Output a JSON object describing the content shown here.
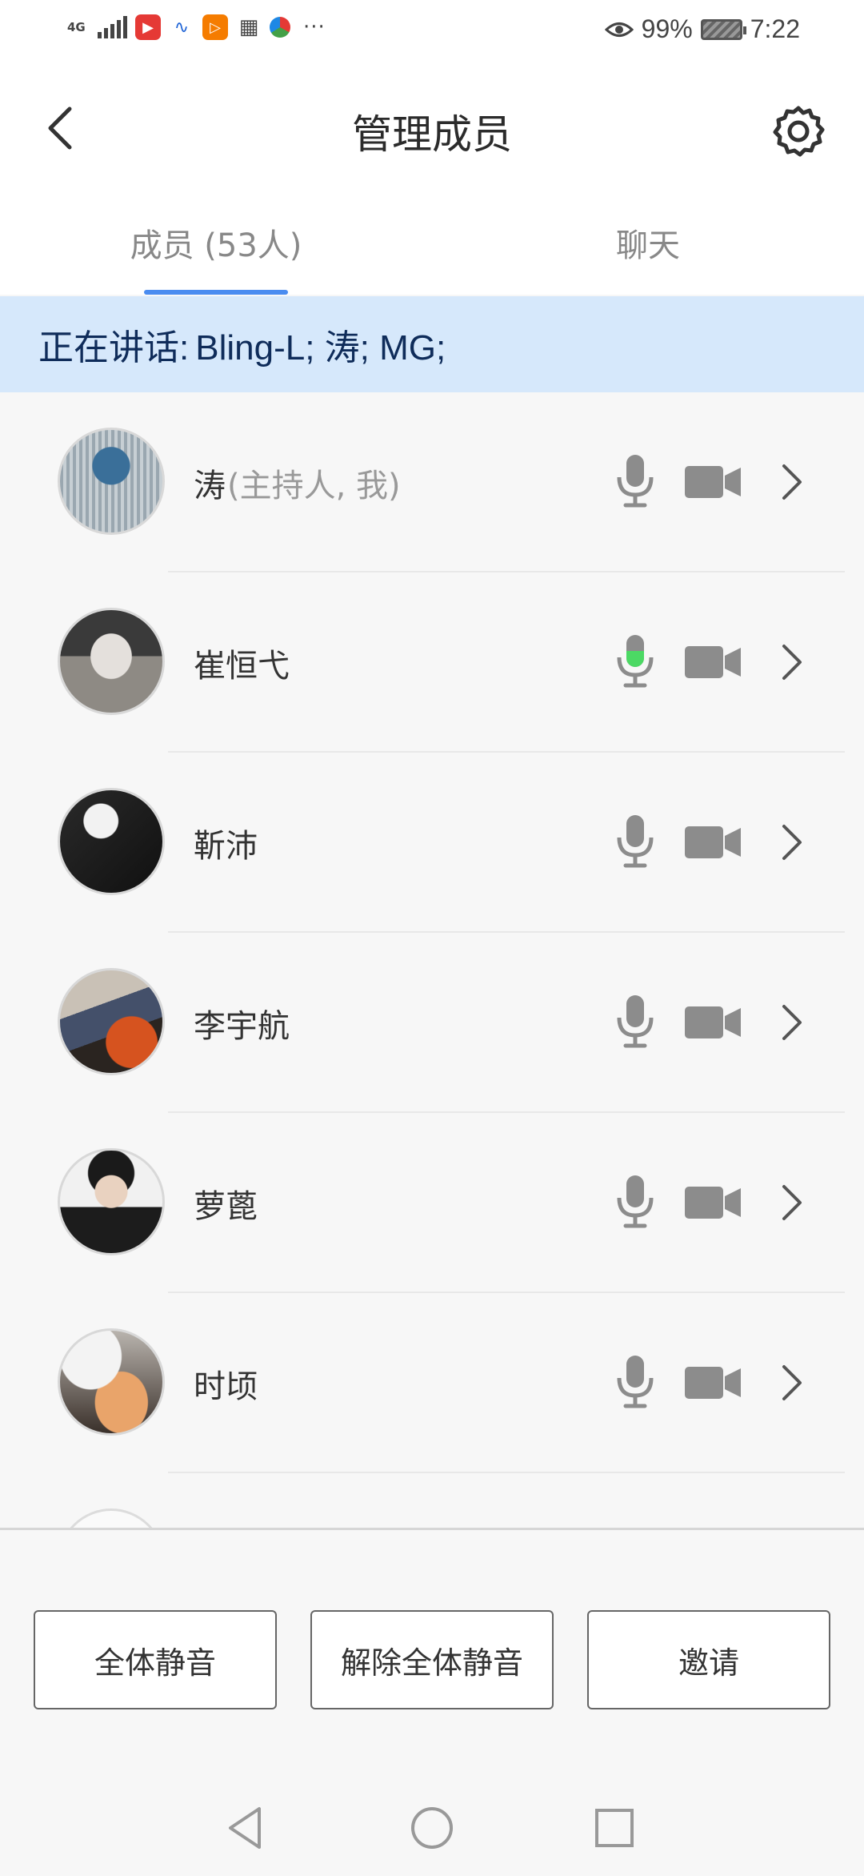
{
  "status_bar": {
    "network": "4G",
    "battery": "99%",
    "time": "7:22",
    "icons": [
      "signal-icon",
      "video-app-icon",
      "app-icon",
      "play-app-icon",
      "calendar-icon",
      "browser-icon",
      "more-dots-icon",
      "eye-icon",
      "battery-icon"
    ]
  },
  "header": {
    "title": "管理成员",
    "back_icon": "back-arrow-icon",
    "settings_icon": "gear-icon"
  },
  "tabs": [
    {
      "label": "成员 (53人)",
      "active": true
    },
    {
      "label": "聊天",
      "active": false
    }
  ],
  "speaking": {
    "label": "正在讲话:",
    "names": "Bling-L; 涛; MG;"
  },
  "members": [
    {
      "name": "涛",
      "role": "(主持人, 我)",
      "mic_active": false
    },
    {
      "name": "崔恒弋",
      "role": "",
      "mic_active": true
    },
    {
      "name": "靳沛",
      "role": "",
      "mic_active": false
    },
    {
      "name": "李宇航",
      "role": "",
      "mic_active": false
    },
    {
      "name": "萝蓖",
      "role": "",
      "mic_active": false
    },
    {
      "name": "时顷",
      "role": "",
      "mic_active": false
    }
  ],
  "actions": {
    "mute_all": "全体静音",
    "unmute_all": "解除全体静音",
    "invite": "邀请"
  },
  "colors": {
    "accent": "#4a8cf0",
    "speaking_bg": "#d6e8fb",
    "mic_active": "#4cd964",
    "icon_gray": "#8c8c8c"
  }
}
